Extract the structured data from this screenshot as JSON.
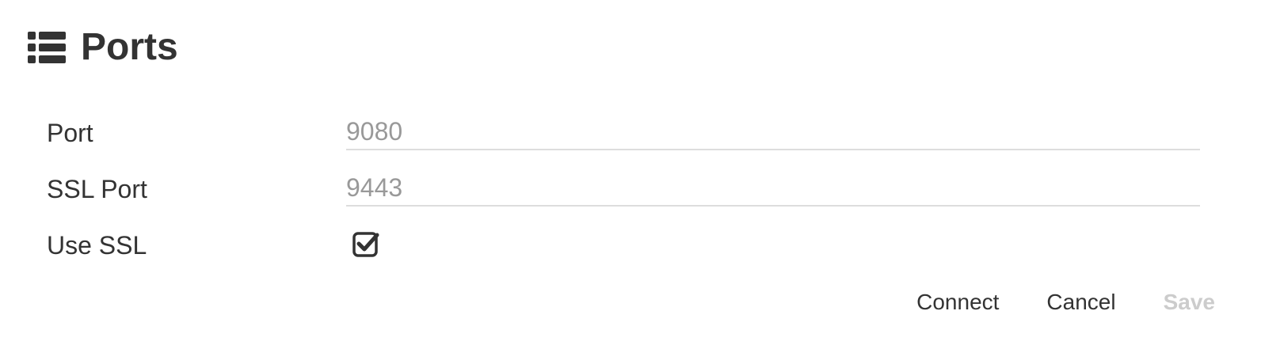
{
  "header": {
    "icon": "list-icon",
    "title": "Ports"
  },
  "form": {
    "port": {
      "label": "Port",
      "placeholder": "9080"
    },
    "ssl_port": {
      "label": "SSL Port",
      "placeholder": "9443"
    },
    "use_ssl": {
      "label": "Use SSL",
      "checked": true,
      "icon": "checkbox-checked-icon"
    }
  },
  "actions": {
    "connect_label": "Connect",
    "cancel_label": "Cancel",
    "save_label": "Save",
    "save_disabled": true
  },
  "colors": {
    "text": "#333333",
    "placeholder": "#999999",
    "underline": "#dddddd",
    "disabled": "#cccccc"
  }
}
